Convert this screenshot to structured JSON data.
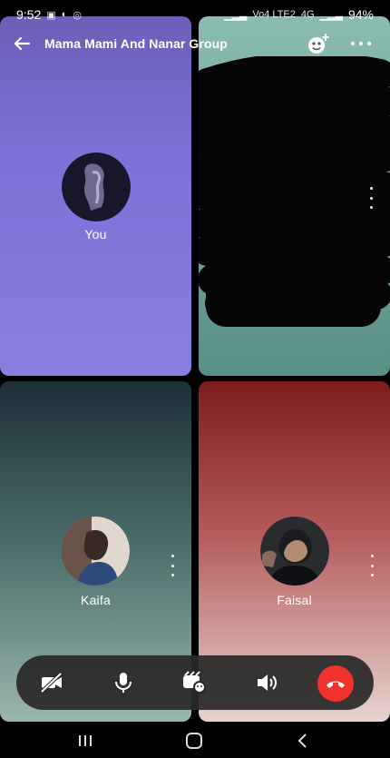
{
  "status_bar": {
    "time": "9:52",
    "network": "Vo4 LTE2",
    "signal_label": "4G",
    "battery": "94%"
  },
  "call": {
    "title": "Mama Mami And Nanar Group"
  },
  "participants": {
    "you": {
      "name": "You"
    },
    "kaifa": {
      "name": "Kaifa"
    },
    "faisal": {
      "name": "Faisal"
    }
  },
  "icons": {
    "back": "back-arrow-icon",
    "add_people": "add-people-icon",
    "more": "more-options-icon",
    "camera": "camera-off-icon",
    "mic": "microphone-icon",
    "effects": "effects-icon",
    "speaker": "speaker-icon",
    "end": "end-call-icon"
  },
  "colors": {
    "end_call": "#f0312e",
    "control_bar": "#282828"
  }
}
